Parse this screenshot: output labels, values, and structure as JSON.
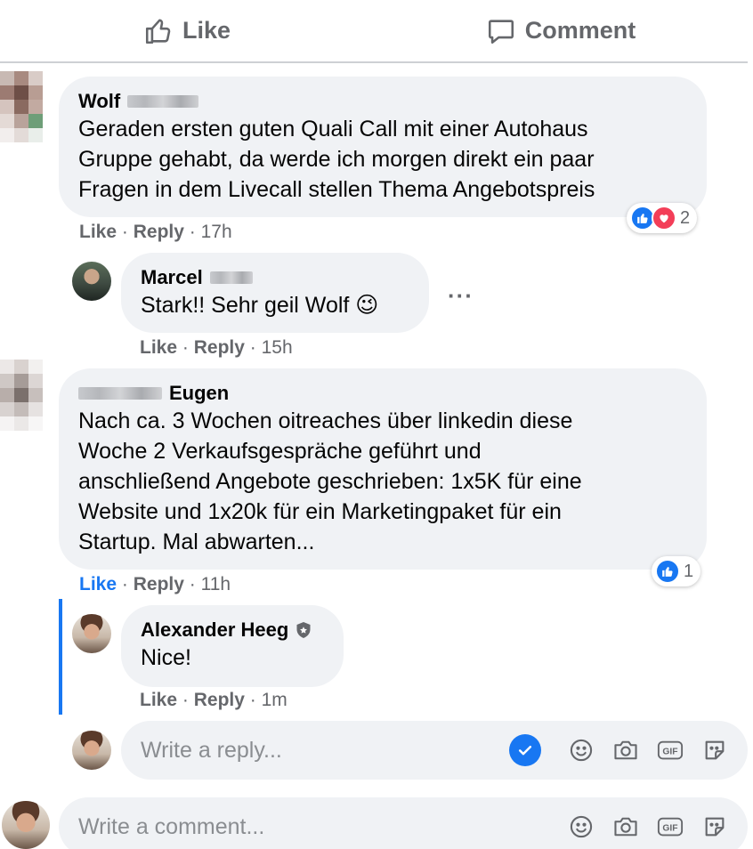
{
  "action_bar": {
    "like_label": "Like",
    "comment_label": "Comment"
  },
  "comments": [
    {
      "author": "Wolf",
      "text": "Geraden ersten guten Quali Call mit einer Autohaus\nGruppe gehabt, da werde ich morgen direkt ein paar\nFragen in dem Livecall stellen Thema Angebotspreis",
      "like": "Like",
      "reply": "Reply",
      "time": "17h",
      "reactions": {
        "count": "2",
        "types": [
          "like",
          "love"
        ]
      }
    },
    {
      "author": "Marcel",
      "text": "Stark!! Sehr geil Wolf 😉",
      "like": "Like",
      "reply": "Reply",
      "time": "15h"
    },
    {
      "author": "Eugen",
      "text": "Nach ca. 3 Wochen oitreaches über linkedin diese\nWoche 2 Verkaufsgespräche geführt und\nanschließend Angebote geschrieben: 1x5K für eine\nWebsite und 1x20k für ein Marketingpaket für ein\nStartup. Mal abwarten...",
      "like": "Like",
      "reply": "Reply",
      "time": "11h",
      "reactions": {
        "count": "1",
        "types": [
          "like"
        ]
      }
    },
    {
      "author": "Alexander Heeg",
      "text": "Nice!",
      "like": "Like",
      "reply": "Reply",
      "time": "1m"
    }
  ],
  "more_options": "···",
  "separator": "·",
  "reply_input": {
    "placeholder": "Write a reply..."
  },
  "comment_input": {
    "placeholder": "Write a comment..."
  },
  "tool_icons": [
    "emoji-icon",
    "camera-icon",
    "gif-icon",
    "sticker-icon"
  ],
  "colors": {
    "accent": "#1877f2",
    "bubble": "#f0f2f5",
    "muted": "#65676b",
    "love": "#f33e58"
  }
}
